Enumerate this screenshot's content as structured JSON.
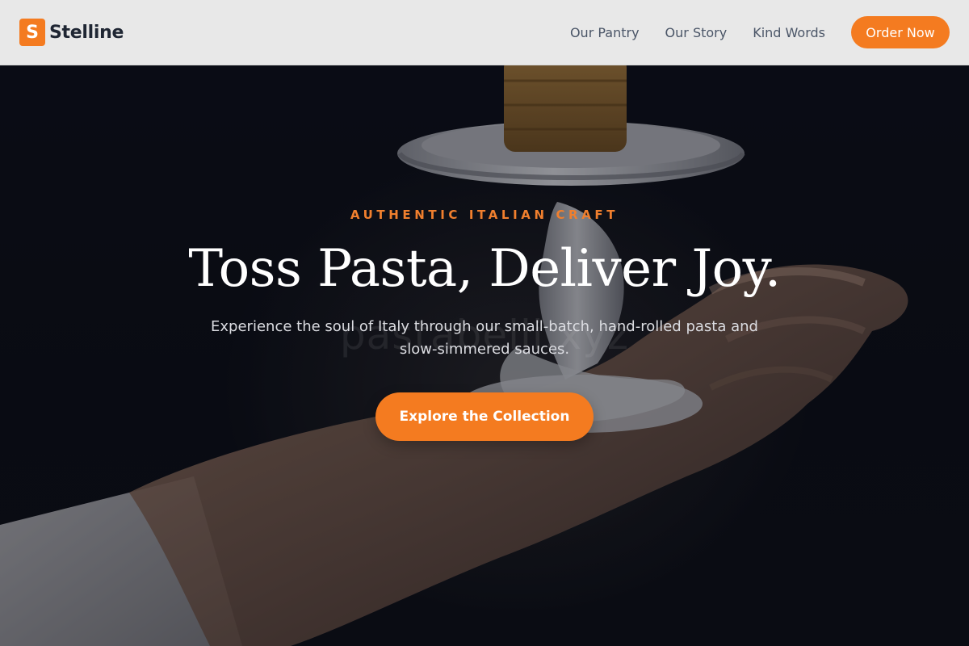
{
  "brand": {
    "logo_letter": "S",
    "name": "Stelline"
  },
  "nav": {
    "links": [
      {
        "label": "Our Pantry"
      },
      {
        "label": "Our Story"
      },
      {
        "label": "Kind Words"
      }
    ],
    "cta_label": "Order Now"
  },
  "hero": {
    "eyebrow": "AUTHENTIC ITALIAN CRAFT",
    "headline": "Toss Pasta, Deliver Joy.",
    "subheadline": "Experience the soul of Italy through our small-batch, hand-rolled pasta and slow-simmered sauces.",
    "cta_label": "Explore the Collection",
    "watermark_text": "pastabelli.xyz"
  },
  "colors": {
    "accent": "#f47b20",
    "eyebrow": "#f07f2e",
    "navbar_bg": "#e8e8e8",
    "hero_bg": "#0b0e14"
  }
}
